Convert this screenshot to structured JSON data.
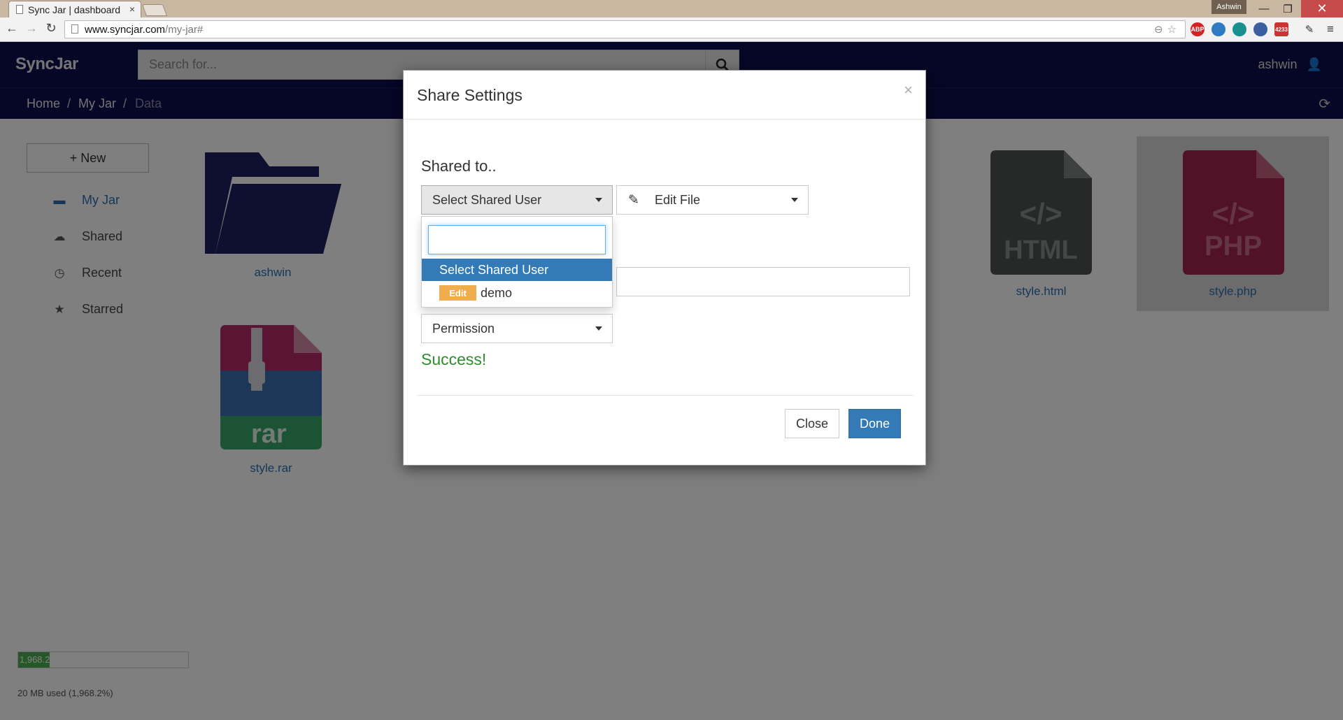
{
  "browser": {
    "tab_title": "Sync Jar | dashboard",
    "tab_close": "×",
    "profile": "Ashwin",
    "url_host": "www.syncjar.com",
    "url_path": "/my-jar#",
    "window_buttons": {
      "minimize": "—",
      "maximize": "❐",
      "close": "✕"
    },
    "extensions": [
      "ABP",
      "4233"
    ]
  },
  "header": {
    "logo": "SyncJar",
    "search_placeholder": "Search for...",
    "username": "ashwin"
  },
  "breadcrumb": [
    "Home",
    "My Jar",
    "Data"
  ],
  "sidebar": {
    "new_button": "+ New",
    "items": [
      {
        "label": "My Jar",
        "icon": "folder-icon"
      },
      {
        "label": "Shared",
        "icon": "cloud-icon"
      },
      {
        "label": "Recent",
        "icon": "clock-icon"
      },
      {
        "label": "Starred",
        "icon": "star-icon"
      }
    ],
    "quota_percent_text": "1,968.2",
    "quota_note": "20 MB used (1,968.2%)"
  },
  "files": [
    {
      "name": "ashwin",
      "type": "folder"
    },
    {
      "name": "style.rar",
      "type": "rar",
      "icon_text": "rar"
    },
    {
      "name": "style.html",
      "type": "html",
      "icon_text": "HTML",
      "code_glyph": "</>"
    },
    {
      "name": "style.php",
      "type": "php",
      "icon_text": "PHP",
      "code_glyph": "</>"
    }
  ],
  "modal": {
    "title": "Share Settings",
    "close_glyph": "×",
    "shared_to_label": "Shared to..",
    "user_select_label": "Select Shared User",
    "file_permission_label": "Edit File",
    "permission_label": "Permission",
    "success_text": "Success!",
    "close_button": "Close",
    "done_button": "Done",
    "dropdown": {
      "active_option": "Select Shared User",
      "options": [
        {
          "tag": "Edit",
          "name": "demo"
        }
      ]
    }
  },
  "colors": {
    "header_bg": "#0d0d4d",
    "link": "#2a6fb2",
    "primary": "#337ab7",
    "success": "#2e8b2e",
    "folder": "#1f1f5e",
    "html_icon": "#4d524f",
    "php_icon": "#a3234f"
  }
}
